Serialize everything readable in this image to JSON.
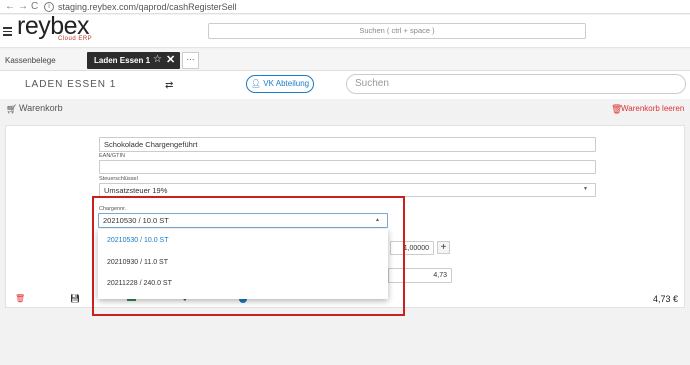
{
  "browser": {
    "back": "←",
    "forward": "→",
    "reload": "C",
    "url": "staging.reybex.com/qaprod/cashRegisterSell"
  },
  "header": {
    "logo": "reybex",
    "logo_sub": "Cloud ERP",
    "search_placeholder": "Suchen ( ctrl + space )"
  },
  "tabs": {
    "plain_label": "Kassenbelege",
    "active_label": "Laden Essen 1",
    "star": "☆",
    "close": "✕",
    "more": "···"
  },
  "store": {
    "name": "LADEN ESSEN 1",
    "swap": "⇄",
    "vk_button": "VK Abteilung",
    "search_placeholder": "Suchen"
  },
  "cart": {
    "title": "Warenkorb",
    "clear": "Warenkorb leeren"
  },
  "item": {
    "name": "Schokolade Chargengeführt",
    "ean_label": "EAN/GTIN",
    "ean_value": "",
    "tax_label": "Steuerschlüssel",
    "tax_value": "Umsatzsteuer 19%",
    "charge_label": "Chargennr.",
    "charge_value": "20210530 / 10.0 ST",
    "charge_options": [
      "20210530 / 10.0 ST",
      "20210930 / 11.0 ST",
      "20211228 / 240.0 ST"
    ],
    "quantity": "1,00000",
    "plus": "+",
    "price": "4,73",
    "total": "4,73 €"
  },
  "colors": {
    "accent": "#1a7cc7",
    "danger": "#d33333",
    "highlight": "#cc1f1f"
  }
}
